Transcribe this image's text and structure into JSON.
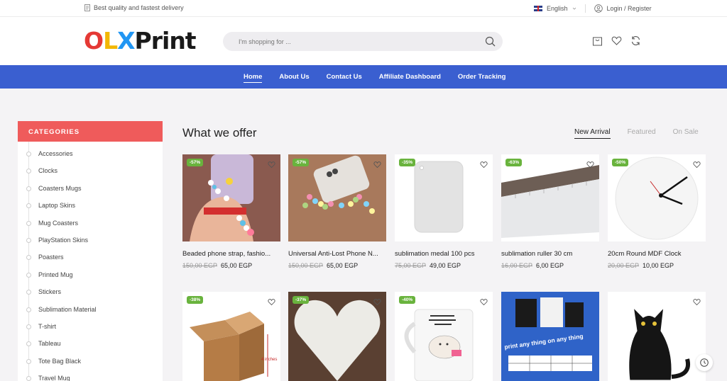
{
  "topbar": {
    "delivery_text": "Best quality and fastest delivery",
    "language": "English",
    "login_text": "Login / Register"
  },
  "header": {
    "logo": {
      "o": "O",
      "l": "L",
      "x": "X",
      "rest": "Print"
    },
    "search_placeholder": "I'm shopping for ..."
  },
  "nav": {
    "items": [
      "Home",
      "About Us",
      "Contact Us",
      "Affiliate Dashboard",
      "Order Tracking"
    ]
  },
  "sidebar": {
    "title": "CATEGORIES",
    "items": [
      "Accessories",
      "Clocks",
      "Coasters Mugs",
      "Laptop Skins",
      "Mug Coasters",
      "PlayStation Skins",
      "Poasters",
      "Printed Mug",
      "Stickers",
      "Sublimation Material",
      "T-shirt",
      "Tableau",
      "Tote Bag Black",
      "Travel Mug"
    ]
  },
  "main": {
    "title": "What we offer",
    "tabs": [
      "New Arrival",
      "Featured",
      "On Sale"
    ],
    "products": [
      {
        "name": "Beaded phone strap, fashio...",
        "old_price": "150,00 EGP",
        "price": "65,00 EGP",
        "badge": "-57%"
      },
      {
        "name": "Universal Anti-Lost Phone N...",
        "old_price": "150,00 EGP",
        "price": "65,00 EGP",
        "badge": "-57%"
      },
      {
        "name": "sublimation medal 100 pcs",
        "old_price": "75,00 EGP",
        "price": "49,00 EGP",
        "badge": "-35%"
      },
      {
        "name": "sublimation ruller 30 cm",
        "old_price": "16,00 EGP",
        "price": "6,00 EGP",
        "badge": "-63%"
      },
      {
        "name": "20cm Round MDF Clock",
        "old_price": "20,00 EGP",
        "price": "10,00 EGP",
        "badge": "-50%"
      }
    ],
    "products_row2": [
      {
        "badge": "-38%",
        "image_text": "4 inches"
      },
      {
        "badge": "-37%"
      },
      {
        "badge": "-40%"
      },
      {
        "image_text": "print any thing on any thing"
      },
      {}
    ]
  },
  "colors": {
    "accent_blue": "#3a5fd0",
    "category_red": "#ef5b5b",
    "badge_green": "#69b33d"
  },
  "icons": [
    "document-icon",
    "flag-icon",
    "user-icon",
    "search-icon",
    "cart-icon",
    "heart-icon",
    "refresh-icon",
    "history-icon"
  ]
}
